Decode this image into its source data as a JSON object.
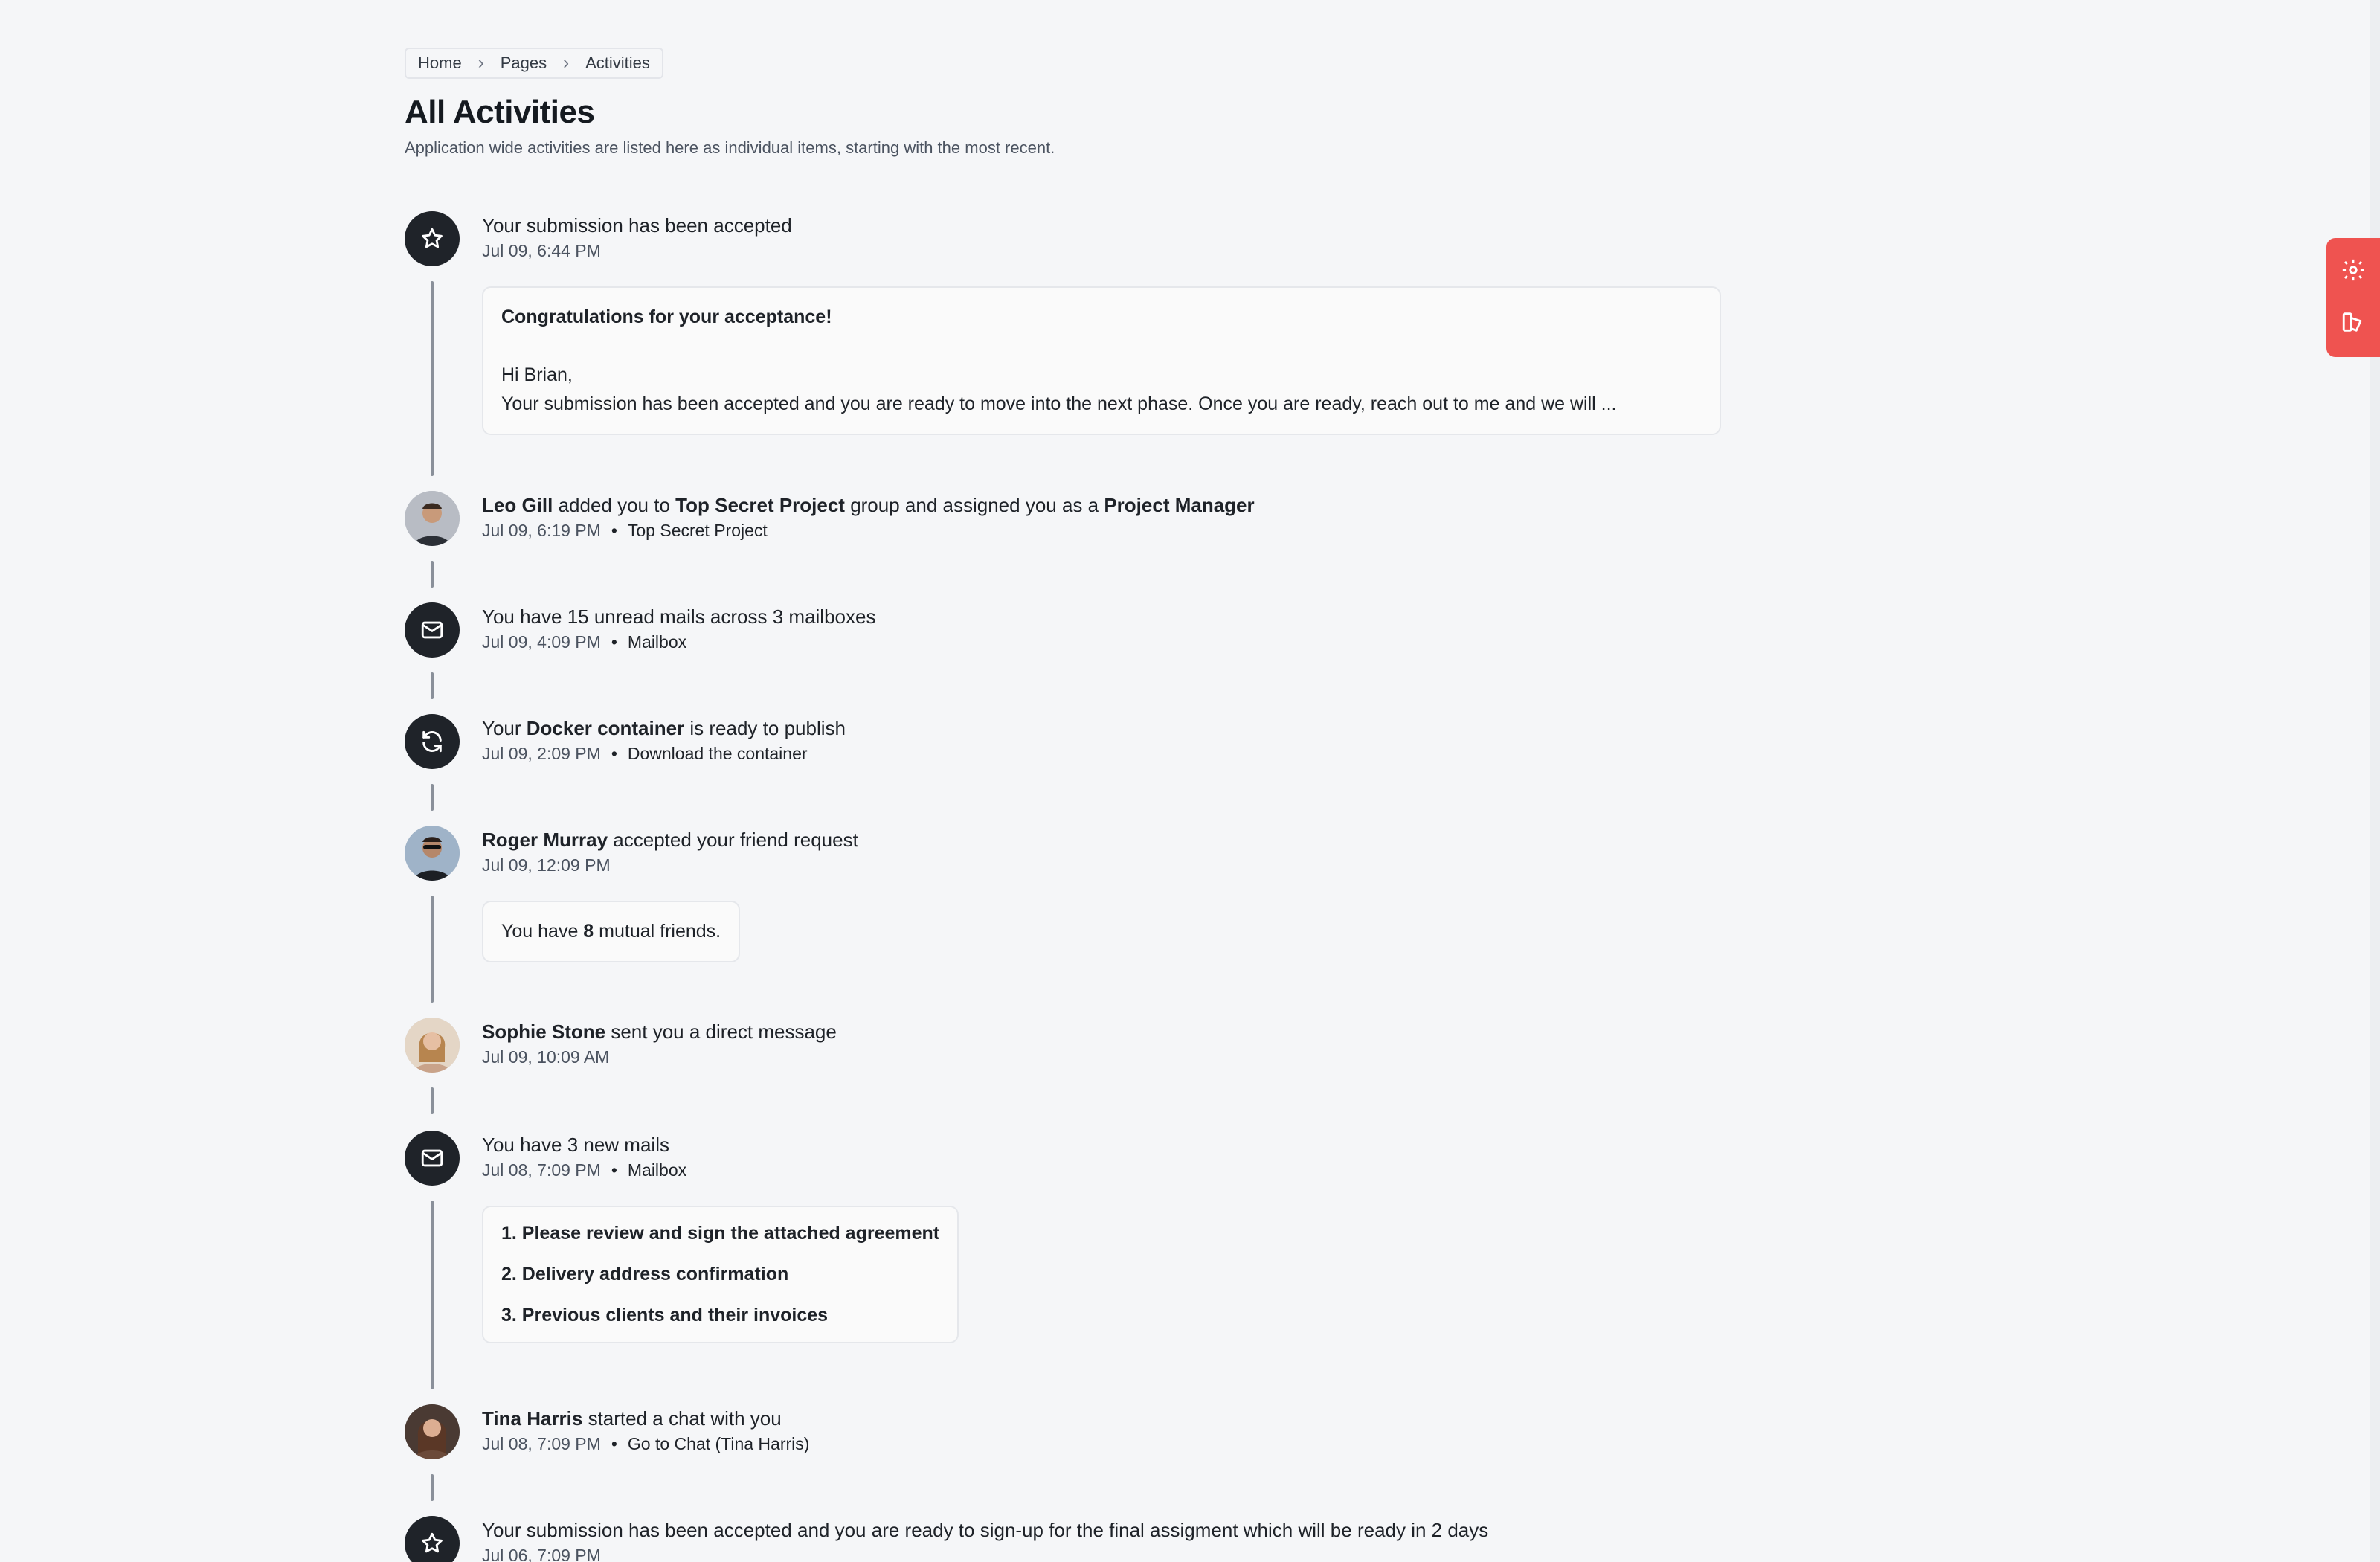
{
  "breadcrumb": {
    "items": [
      "Home",
      "Pages",
      "Activities"
    ],
    "separator": "›"
  },
  "header": {
    "title": "All Activities",
    "subtitle": "Application wide activities are listed here as individual items, starting with the most recent."
  },
  "activities": [
    {
      "icon": "star-icon",
      "title": "Your submission has been accepted",
      "time": "Jul 09, 6:44 PM",
      "card": {
        "heading": "Congratulations for your acceptance!",
        "greeting": "Hi Brian,",
        "body": "Your submission has been accepted and you are ready to move into the next phase. Once you are ready, reach out to me and we will ..."
      }
    },
    {
      "avatar": "leo-gill-avatar",
      "title_parts": {
        "actor": "Leo Gill",
        "t1": " added you to ",
        "project": "Top Secret Project",
        "t2": " group and assigned you as a ",
        "role": "Project Manager"
      },
      "time": "Jul 09, 6:19 PM",
      "link": "Top Secret Project"
    },
    {
      "icon": "mail-icon",
      "title": "You have 15 unread mails across 3 mailboxes",
      "time": "Jul 09, 4:09 PM",
      "link": "Mailbox"
    },
    {
      "icon": "refresh-icon",
      "title_parts": {
        "t1": "Your ",
        "item": "Docker container",
        "t2": " is ready to publish"
      },
      "time": "Jul 09, 2:09 PM",
      "link": "Download the container"
    },
    {
      "avatar": "roger-murray-avatar",
      "title_parts": {
        "actor": "Roger Murray",
        "t1": " accepted your friend request"
      },
      "time": "Jul 09, 12:09 PM",
      "card": {
        "t1": "You have ",
        "count": "8",
        "t2": " mutual friends."
      }
    },
    {
      "avatar": "sophie-stone-avatar",
      "title_parts": {
        "actor": "Sophie Stone",
        "t1": " sent you a direct message"
      },
      "time": "Jul 09, 10:09 AM"
    },
    {
      "icon": "mail-icon",
      "title": "You have 3 new mails",
      "time": "Jul 08, 7:09 PM",
      "link": "Mailbox",
      "mails": [
        "1. Please review and sign the attached agreement",
        "2. Delivery address confirmation",
        "3. Previous clients and their invoices"
      ]
    },
    {
      "avatar": "tina-harris-avatar",
      "title_parts": {
        "actor": "Tina Harris",
        "t1": " started a chat with you"
      },
      "time": "Jul 08, 7:09 PM",
      "link": "Go to Chat (Tina Harris)"
    },
    {
      "icon": "star-icon",
      "title": "Your submission has been accepted and you are ready to sign-up for the final assigment which will be ready in 2 days",
      "time": "Jul 06, 7:09 PM"
    }
  ],
  "side_panel": {
    "icons": [
      "settings-icon",
      "theme-icon"
    ],
    "color": "#ef5350"
  },
  "colors": {
    "badge": "#1f2329",
    "line": "#8a909a",
    "background": "#f5f6f8"
  }
}
